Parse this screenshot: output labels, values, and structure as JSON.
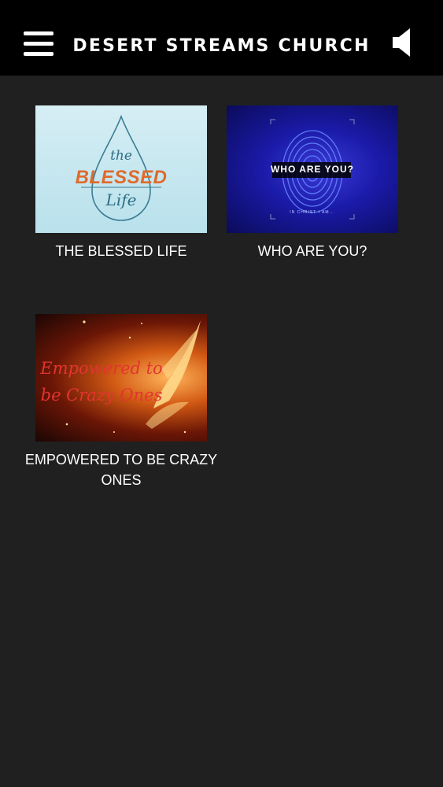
{
  "header": {
    "title": "DESERT STREAMS CHURCH",
    "menu_icon": "hamburger-menu-icon",
    "sound_icon": "speaker-icon"
  },
  "series": [
    {
      "title": "THE BLESSED LIFE",
      "thumbnail": {
        "line1": "the",
        "line2": "BLESSED",
        "line3": "Life"
      }
    },
    {
      "title": "WHO ARE YOU?",
      "thumbnail": {
        "heading": "WHO ARE YOU?",
        "sub": "IN CHRIST I AM..."
      }
    },
    {
      "title": "EMPOWERED TO BE CRAZY ONES",
      "thumbnail": {
        "text": "Empowered to be Crazy Ones"
      }
    }
  ],
  "colors": {
    "background": "#202020",
    "header": "#000000",
    "accent_orange": "#e06a2c",
    "accent_red": "#e3342f"
  }
}
